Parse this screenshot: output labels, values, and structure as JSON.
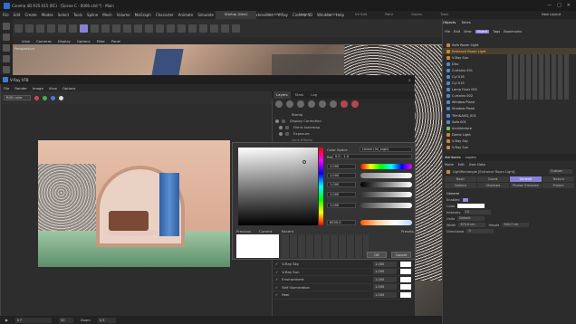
{
  "app": {
    "title": "Cinema 4D R25.015 (RC) - [Scene C - 0006.c4d *] - Main"
  },
  "menu": [
    "File",
    "Edit",
    "Create",
    "Modes",
    "Select",
    "Tools",
    "Spline",
    "Mesh",
    "Volume",
    "MoGraph",
    "Character",
    "Animate",
    "Simulate",
    "Tracker",
    "Render",
    "Extensions",
    "V-Ray",
    "Cinema 4D",
    "Window",
    "Help"
  ],
  "layouts": [
    "Startup (User)",
    "Standard",
    "Model",
    "Sculpt",
    "UV Edit",
    "Paint",
    "Groom",
    "Track",
    "Script",
    "Nodes",
    "Help Alert",
    "Classic (OS) (User)"
  ],
  "new_layout": "New Layout",
  "viewport": {
    "menu": [
      "View",
      "Cameras",
      "Display",
      "Options",
      "Filter",
      "Panel"
    ],
    "label": "Perspective"
  },
  "vfb": {
    "title": "V-Ray VFB",
    "close": "×",
    "menu": [
      "File",
      "Render",
      "Image",
      "View",
      "Options"
    ],
    "colorspace_select": "RGB color",
    "layer_tabs": [
      "Layers",
      "Stats",
      "Log"
    ],
    "layers": [
      "Stamp",
      "Display Correction",
      "Filmic tonemap",
      "Exposure",
      "Lens Effects"
    ],
    "bottom_rows": [
      {
        "label": "V-Ray Sky",
        "value": "1.000"
      },
      {
        "label": "V-Ray Sun",
        "value": "1.000"
      },
      {
        "label": "Environment",
        "value": "1.000"
      },
      {
        "label": "Self Illumination",
        "value": "1.000"
      },
      {
        "label": "Reel",
        "value": "1.000"
      }
    ]
  },
  "picker": {
    "color_space_label": "Color Space",
    "color_space_value": "Linear (lin_srgb)",
    "range_label": "Range",
    "range_value": "0.0 - 1.0",
    "channels": [
      "1.000",
      "1.000",
      "1.000",
      "1.000",
      "1.000"
    ],
    "temp": "6500.0",
    "previous": "Previous",
    "current": "Current",
    "recent": "Recent",
    "presets": "Presets",
    "ok": "OK",
    "cancel": "Cancel"
  },
  "objects": {
    "tabs": [
      "Objects",
      "Takes"
    ],
    "menu": [
      "File",
      "Edit",
      "View",
      "Object",
      "Tags",
      "Bookmarks"
    ],
    "items": [
      "Sofa Room Light",
      "Entrance Room Light",
      "V-Ray Sun",
      "Disc",
      "Curtains 001",
      "Cyl 016",
      "Cyl 015",
      "Lamp Floor 001",
      "Curtains 002",
      "Window Plane",
      "Shadow Plane",
      "Trim&AAD_001",
      "Sofa 001",
      "Architecture",
      "Dome Light",
      "V-Ray Sky",
      "V-Ray Sun"
    ]
  },
  "attributes": {
    "tabs": [
      "Attributes",
      "Layers"
    ],
    "menu": [
      "Mode",
      "Edit",
      "User Data"
    ],
    "object_name": "LightRectangle [Entrance Room Light]",
    "mode": "Custom",
    "section_tabs": [
      "Basic",
      "Coord.",
      "General",
      "Texture",
      "Options",
      "Shadows",
      "Photon Emission",
      "Project"
    ],
    "section": "General",
    "rows": [
      {
        "label": "Enabled",
        "value": "✓"
      },
      {
        "label": "Color",
        "value": ""
      },
      {
        "label": "Intensity",
        "value": "10"
      },
      {
        "label": "Units",
        "value": "Default"
      },
      {
        "label": "Width",
        "value": "670.8 cm"
      },
      {
        "label": "Height",
        "value": "304.7 cm"
      },
      {
        "label": "Directional",
        "value": "0"
      }
    ]
  },
  "status": {
    "frame": "0 F",
    "fps": "30",
    "zoom_label": "Zoom",
    "zoom": "0.5"
  }
}
